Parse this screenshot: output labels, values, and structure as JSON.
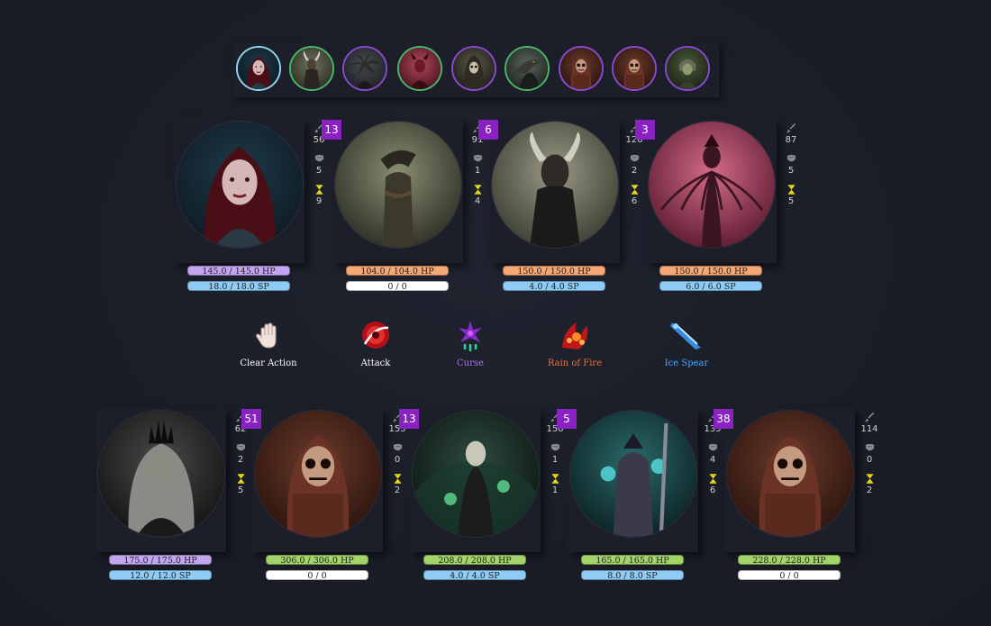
{
  "turn_order": [
    {
      "name": "portrait-red-haired-woman",
      "ring": "#8fd4f0"
    },
    {
      "name": "portrait-horned-demon",
      "ring": "#4ab66a"
    },
    {
      "name": "portrait-medusa",
      "ring": "#8a4ad0"
    },
    {
      "name": "portrait-red-demon",
      "ring": "#4ab66a"
    },
    {
      "name": "portrait-hooded-skull",
      "ring": "#8a4ad0"
    },
    {
      "name": "portrait-dragon",
      "ring": "#4ab66a"
    },
    {
      "name": "portrait-skeleton-knight",
      "ring": "#8a4ad0"
    },
    {
      "name": "portrait-skeleton-knight",
      "ring": "#8a4ad0"
    },
    {
      "name": "portrait-armored-zombie",
      "ring": "#8a4ad0"
    }
  ],
  "enemies": [
    {
      "badge": "",
      "attack": "56",
      "defense": "5",
      "speed": "9",
      "hp": "145.0 / 145.0 HP",
      "sp": "18.0 / 18.0 SP",
      "hp_color": "#c3a6f2",
      "sp_color": "#8ecbf5"
    },
    {
      "badge": "13",
      "attack": "91",
      "defense": "1",
      "speed": "4",
      "hp": "104.0 / 104.0 HP",
      "sp": "0 / 0",
      "hp_color": "#f5a774",
      "sp_color": "#ffffff"
    },
    {
      "badge": "6",
      "attack": "126",
      "defense": "2",
      "speed": "6",
      "hp": "150.0 / 150.0 HP",
      "sp": "4.0 / 4.0 SP",
      "hp_color": "#f5a774",
      "sp_color": "#8ecbf5"
    },
    {
      "badge": "3",
      "attack": "87",
      "defense": "5",
      "speed": "5",
      "hp": "150.0 / 150.0 HP",
      "sp": "6.0 / 6.0 SP",
      "hp_color": "#f5a774",
      "sp_color": "#8ecbf5"
    }
  ],
  "actions": [
    {
      "label": "Clear Action",
      "color": "#ffffff",
      "icon": "hand-icon"
    },
    {
      "label": "Attack",
      "color": "#ffffff",
      "icon": "attack-icon"
    },
    {
      "label": "Curse",
      "color": "#b36ef5",
      "icon": "curse-icon"
    },
    {
      "label": "Rain of Fire",
      "color": "#ff6a2b",
      "icon": "fire-icon"
    },
    {
      "label": "Ice Spear",
      "color": "#4aa6ff",
      "icon": "ice-spear-icon"
    }
  ],
  "allies": [
    {
      "badge": "",
      "attack": "62",
      "defense": "2",
      "speed": "5",
      "hp": "175.0 / 175.0 HP",
      "sp": "12.0 / 12.0 SP",
      "hp_color": "#c3a6f2",
      "sp_color": "#8ecbf5"
    },
    {
      "badge": "51",
      "attack": "153",
      "defense": "0",
      "speed": "2",
      "hp": "306.0 / 306.0 HP",
      "sp": "0 / 0",
      "hp_color": "#a3d46a",
      "sp_color": "#ffffff"
    },
    {
      "badge": "13",
      "attack": "156",
      "defense": "1",
      "speed": "1",
      "hp": "208.0 / 208.0 HP",
      "sp": "4.0 / 4.0 SP",
      "hp_color": "#a3d46a",
      "sp_color": "#8ecbf5"
    },
    {
      "badge": "5",
      "attack": "135",
      "defense": "4",
      "speed": "6",
      "hp": "165.0 / 165.0 HP",
      "sp": "8.0 / 8.0 SP",
      "hp_color": "#a3d46a",
      "sp_color": "#8ecbf5"
    },
    {
      "badge": "38",
      "attack": "114",
      "defense": "0",
      "speed": "2",
      "hp": "228.0 / 228.0 HP",
      "sp": "0 / 0",
      "hp_color": "#a3d46a",
      "sp_color": "#ffffff"
    }
  ]
}
